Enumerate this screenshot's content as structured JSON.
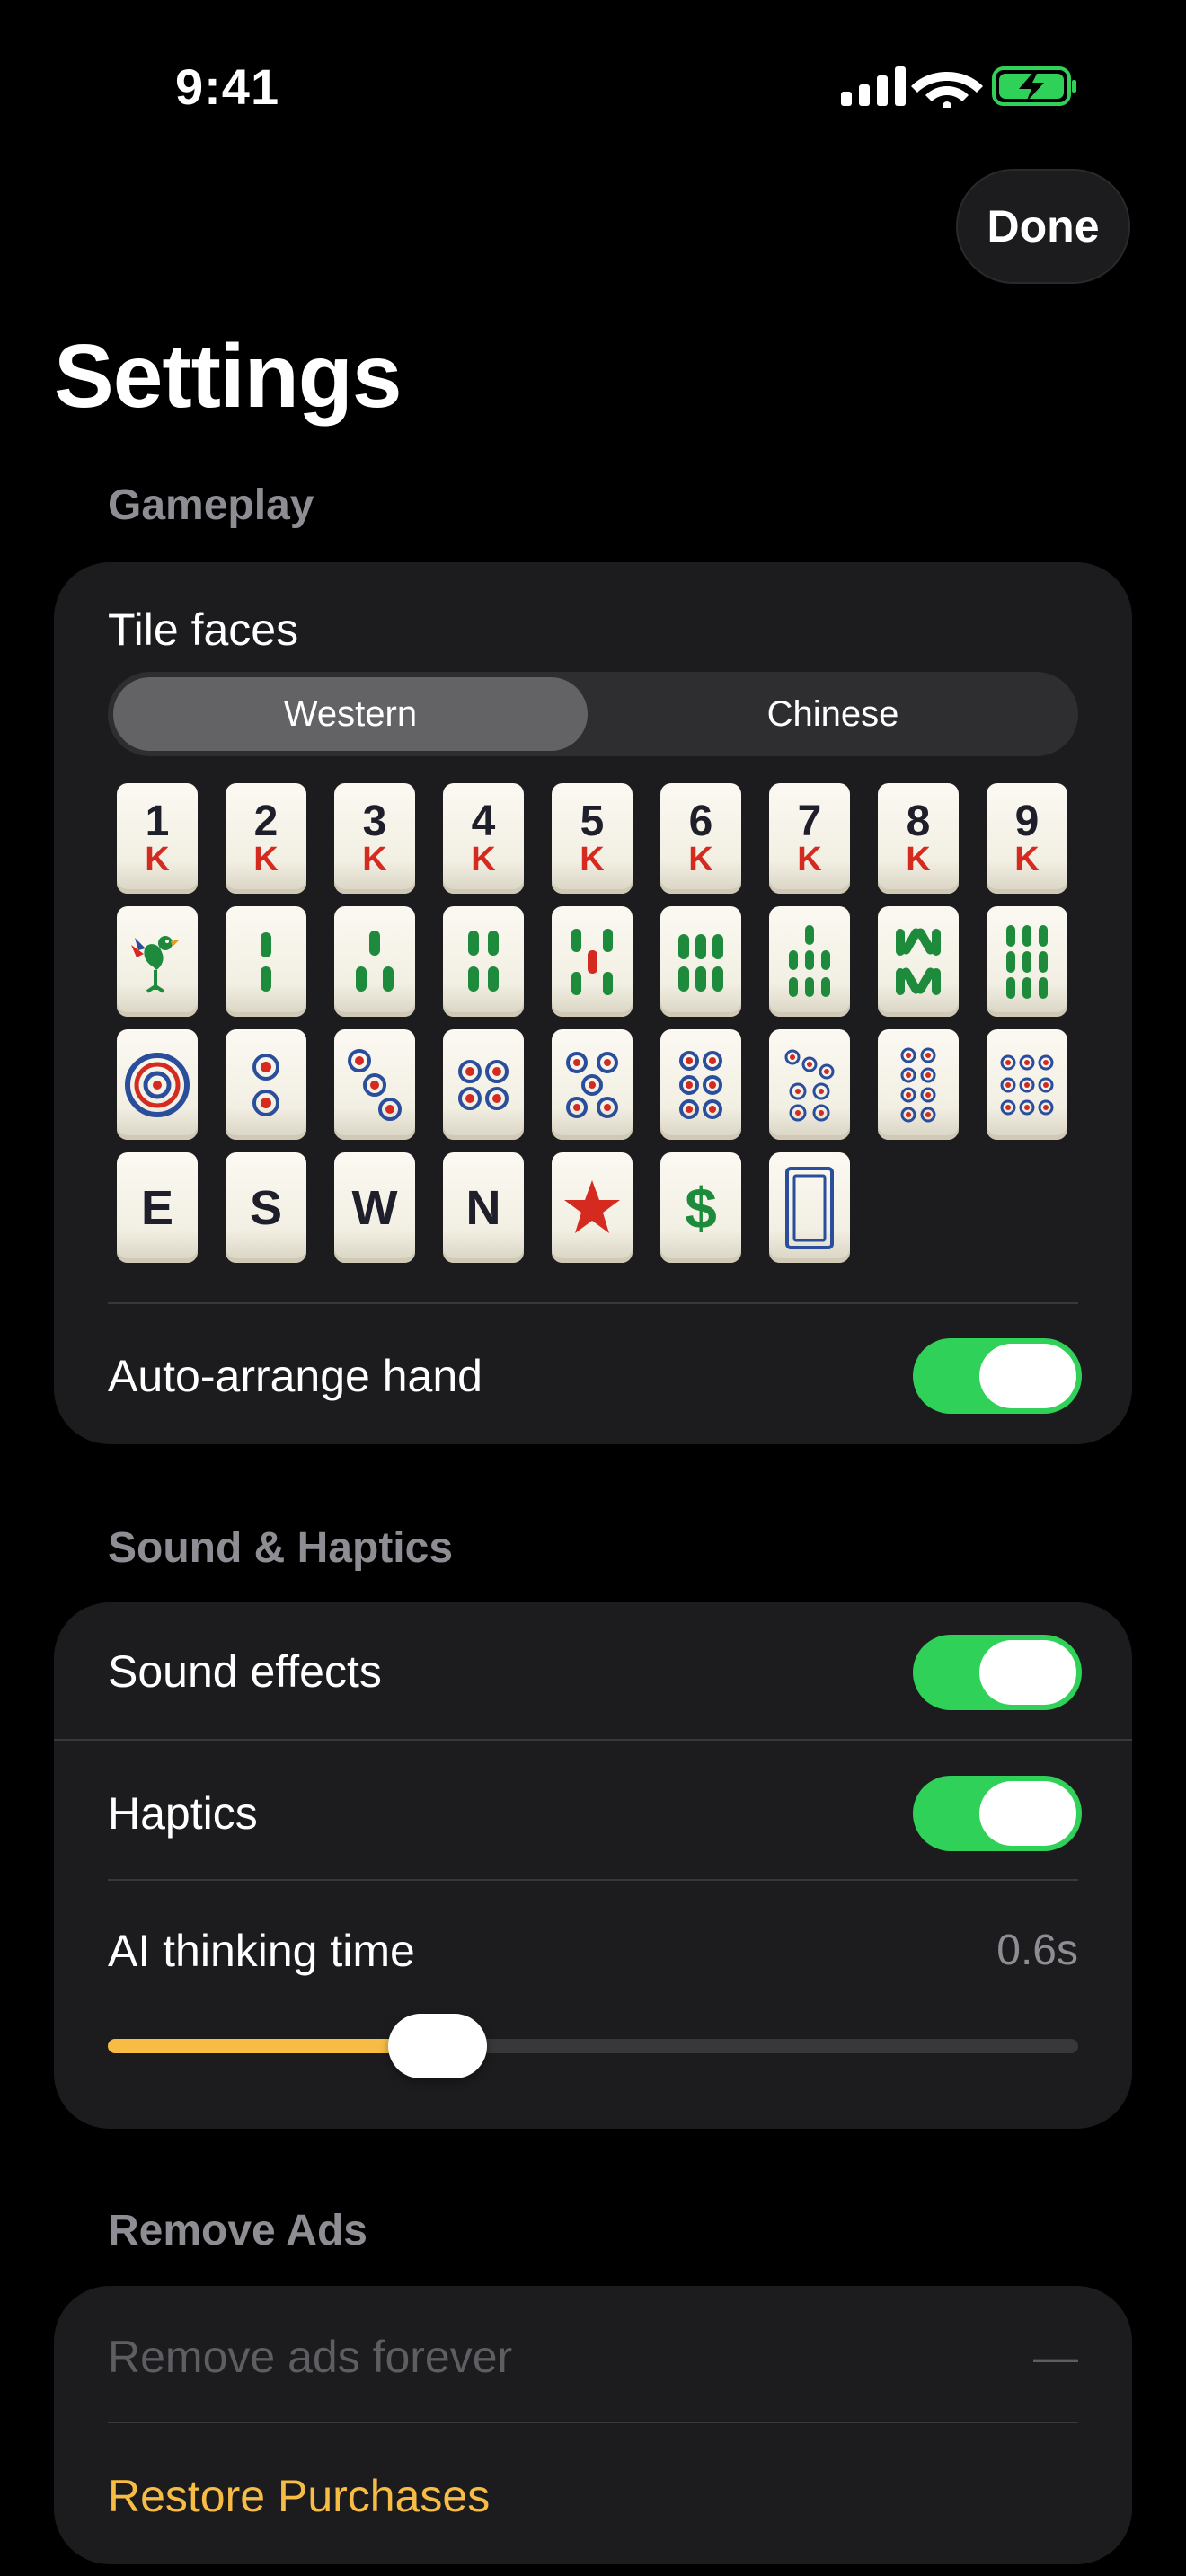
{
  "status_bar": {
    "time": "9:41"
  },
  "nav": {
    "done_label": "Done",
    "title": "Settings"
  },
  "gameplay": {
    "header": "Gameplay",
    "tile_faces_label": "Tile faces",
    "segments": [
      {
        "label": "Western",
        "selected": true
      },
      {
        "label": "Chinese",
        "selected": false
      }
    ],
    "character_tiles": [
      {
        "num": "1",
        "mark": "K"
      },
      {
        "num": "2",
        "mark": "K"
      },
      {
        "num": "3",
        "mark": "K"
      },
      {
        "num": "4",
        "mark": "K"
      },
      {
        "num": "5",
        "mark": "K"
      },
      {
        "num": "6",
        "mark": "K"
      },
      {
        "num": "7",
        "mark": "K"
      },
      {
        "num": "8",
        "mark": "K"
      },
      {
        "num": "9",
        "mark": "K"
      }
    ],
    "bamboo_tiles": [
      "bamboo-1-bird-icon",
      "bamboo-2-icon",
      "bamboo-3-icon",
      "bamboo-4-icon",
      "bamboo-5-icon",
      "bamboo-6-icon",
      "bamboo-7-icon",
      "bamboo-8-icon",
      "bamboo-9-icon"
    ],
    "dot_tiles": [
      "dots-1-icon",
      "dots-2-icon",
      "dots-3-icon",
      "dots-4-icon",
      "dots-5-icon",
      "dots-6-icon",
      "dots-7-icon",
      "dots-8-icon",
      "dots-9-icon"
    ],
    "honor_tiles": {
      "winds": [
        "E",
        "S",
        "W",
        "N"
      ],
      "dragon_red": "red-star-icon",
      "dragon_green": "$",
      "dragon_white": "white-dragon-frame-icon"
    },
    "auto_arrange_label": "Auto-arrange hand",
    "auto_arrange_on": true
  },
  "sound": {
    "header": "Sound & Haptics",
    "sound_effects_label": "Sound effects",
    "sound_effects_on": true,
    "haptics_label": "Haptics",
    "haptics_on": true,
    "ai_thinking_label": "AI thinking time",
    "ai_thinking_value": "0.6s",
    "ai_thinking_level_fraction": 0.34
  },
  "remove_ads": {
    "header": "Remove Ads",
    "remove_forever_label": "Remove ads forever",
    "remove_forever_price": "—",
    "restore_label": "Restore Purchases"
  },
  "colors": {
    "toggle_on": "#30d158",
    "accent_gold": "#f7bc44",
    "card_bg": "#1c1c1e",
    "character_red": "#d42a20",
    "bamboo_green": "#1e8a3c",
    "dot_blue": "#2b4e9c"
  }
}
